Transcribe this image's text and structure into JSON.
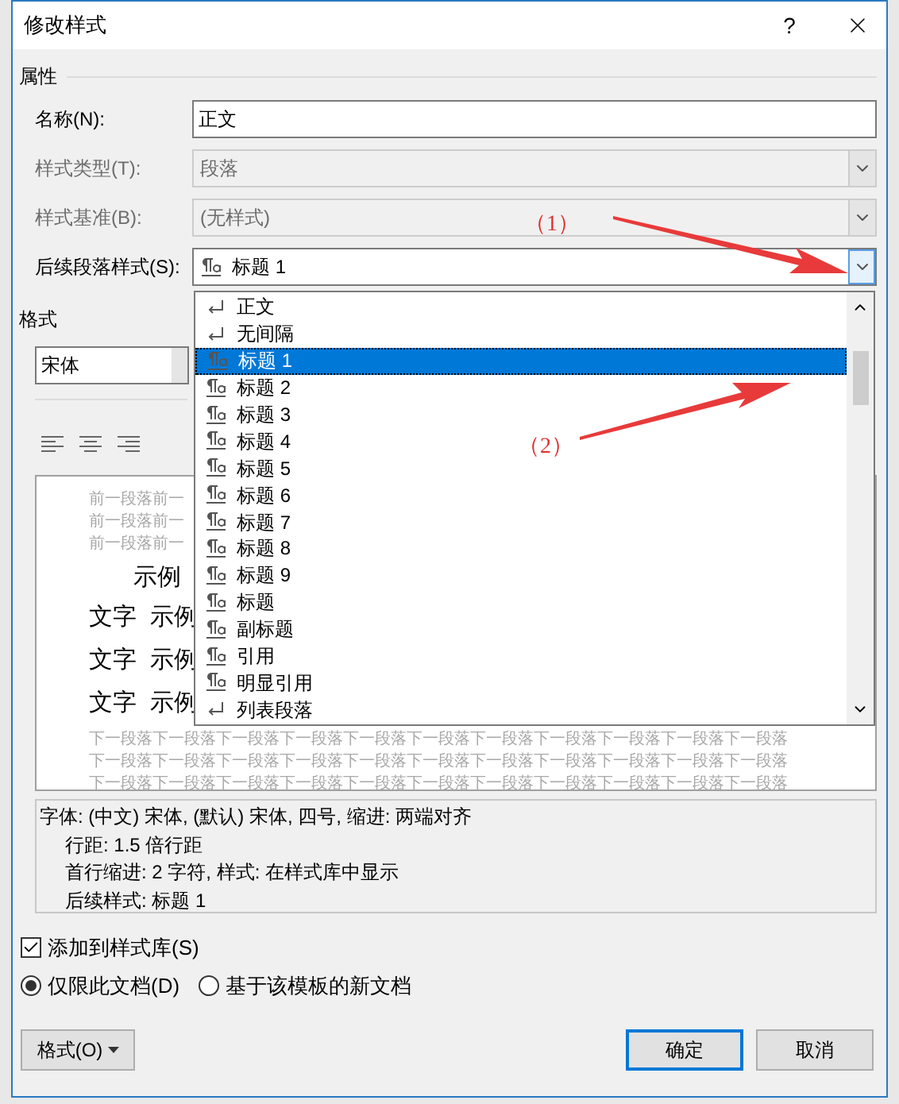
{
  "window": {
    "title": "修改样式",
    "help": "?"
  },
  "properties": {
    "heading": "属性",
    "fields": [
      {
        "label": "名称(N):",
        "value": "正文",
        "kind": "text",
        "disabled": false
      },
      {
        "label": "样式类型(T):",
        "value": "段落",
        "kind": "select",
        "disabled": true
      },
      {
        "label": "样式基准(B):",
        "value": "(无样式)",
        "kind": "select",
        "disabled": true,
        "annotation": "（1）"
      },
      {
        "label": "后续段落样式(S):",
        "value": "标题 1",
        "kind": "select",
        "disabled": false,
        "expanded": true
      }
    ]
  },
  "style_list": [
    {
      "label": "正文",
      "kind": "paragraph",
      "selected": false
    },
    {
      "label": "无间隔",
      "kind": "paragraph",
      "selected": false
    },
    {
      "label": "标题 1",
      "kind": "linked",
      "selected": true
    },
    {
      "label": "标题 2",
      "kind": "linked",
      "selected": false
    },
    {
      "label": "标题 3",
      "kind": "linked",
      "selected": false
    },
    {
      "label": "标题 4",
      "kind": "linked",
      "selected": false
    },
    {
      "label": "标题 5",
      "kind": "linked",
      "selected": false
    },
    {
      "label": "标题 6",
      "kind": "linked",
      "selected": false
    },
    {
      "label": "标题 7",
      "kind": "linked",
      "selected": false
    },
    {
      "label": "标题 8",
      "kind": "linked",
      "selected": false
    },
    {
      "label": "标题 9",
      "kind": "linked",
      "selected": false
    },
    {
      "label": "标题",
      "kind": "linked",
      "selected": false
    },
    {
      "label": "副标题",
      "kind": "linked",
      "selected": false
    },
    {
      "label": "引用",
      "kind": "linked",
      "selected": false
    },
    {
      "label": "明显引用",
      "kind": "linked",
      "selected": false
    },
    {
      "label": "列表段落",
      "kind": "paragraph",
      "selected": false
    }
  ],
  "format": {
    "heading": "格式",
    "font": "宋体"
  },
  "preview": {
    "before_lines": [
      "前一段落前一",
      "前一段落前一",
      "前一段落前一"
    ],
    "sample_heading": "示例",
    "sample_lines": [
      "文字  示例",
      "文字  示例",
      "文字  示例"
    ],
    "after_lines": [
      "下一段落下一段落下一段落下一段落下一段落下一段落下一段落下一段落下一段落下一段落下一段落",
      "下一段落下一段落下一段落下一段落下一段落下一段落下一段落下一段落下一段落下一段落下一段落",
      "下一段落下一段落下一段落下一段落下一段落下一段落下一段落下一段落下一段落下一段落下一段落"
    ]
  },
  "description": [
    "字体: (中文) 宋体, (默认) 宋体, 四号, 缩进: 两端对齐",
    "行距: 1.5 倍行距",
    "首行缩进:  2 字符, 样式: 在样式库中显示",
    "后续样式: 标题 1"
  ],
  "add_to_gallery": {
    "label": "添加到样式库(S)",
    "checked": true
  },
  "scope": [
    {
      "label": "仅限此文档(D)",
      "selected": true
    },
    {
      "label": "基于该模板的新文档",
      "selected": false
    }
  ],
  "buttons": {
    "format": "格式(O)",
    "ok": "确定",
    "cancel": "取消"
  },
  "annotations": [
    "（2）"
  ]
}
